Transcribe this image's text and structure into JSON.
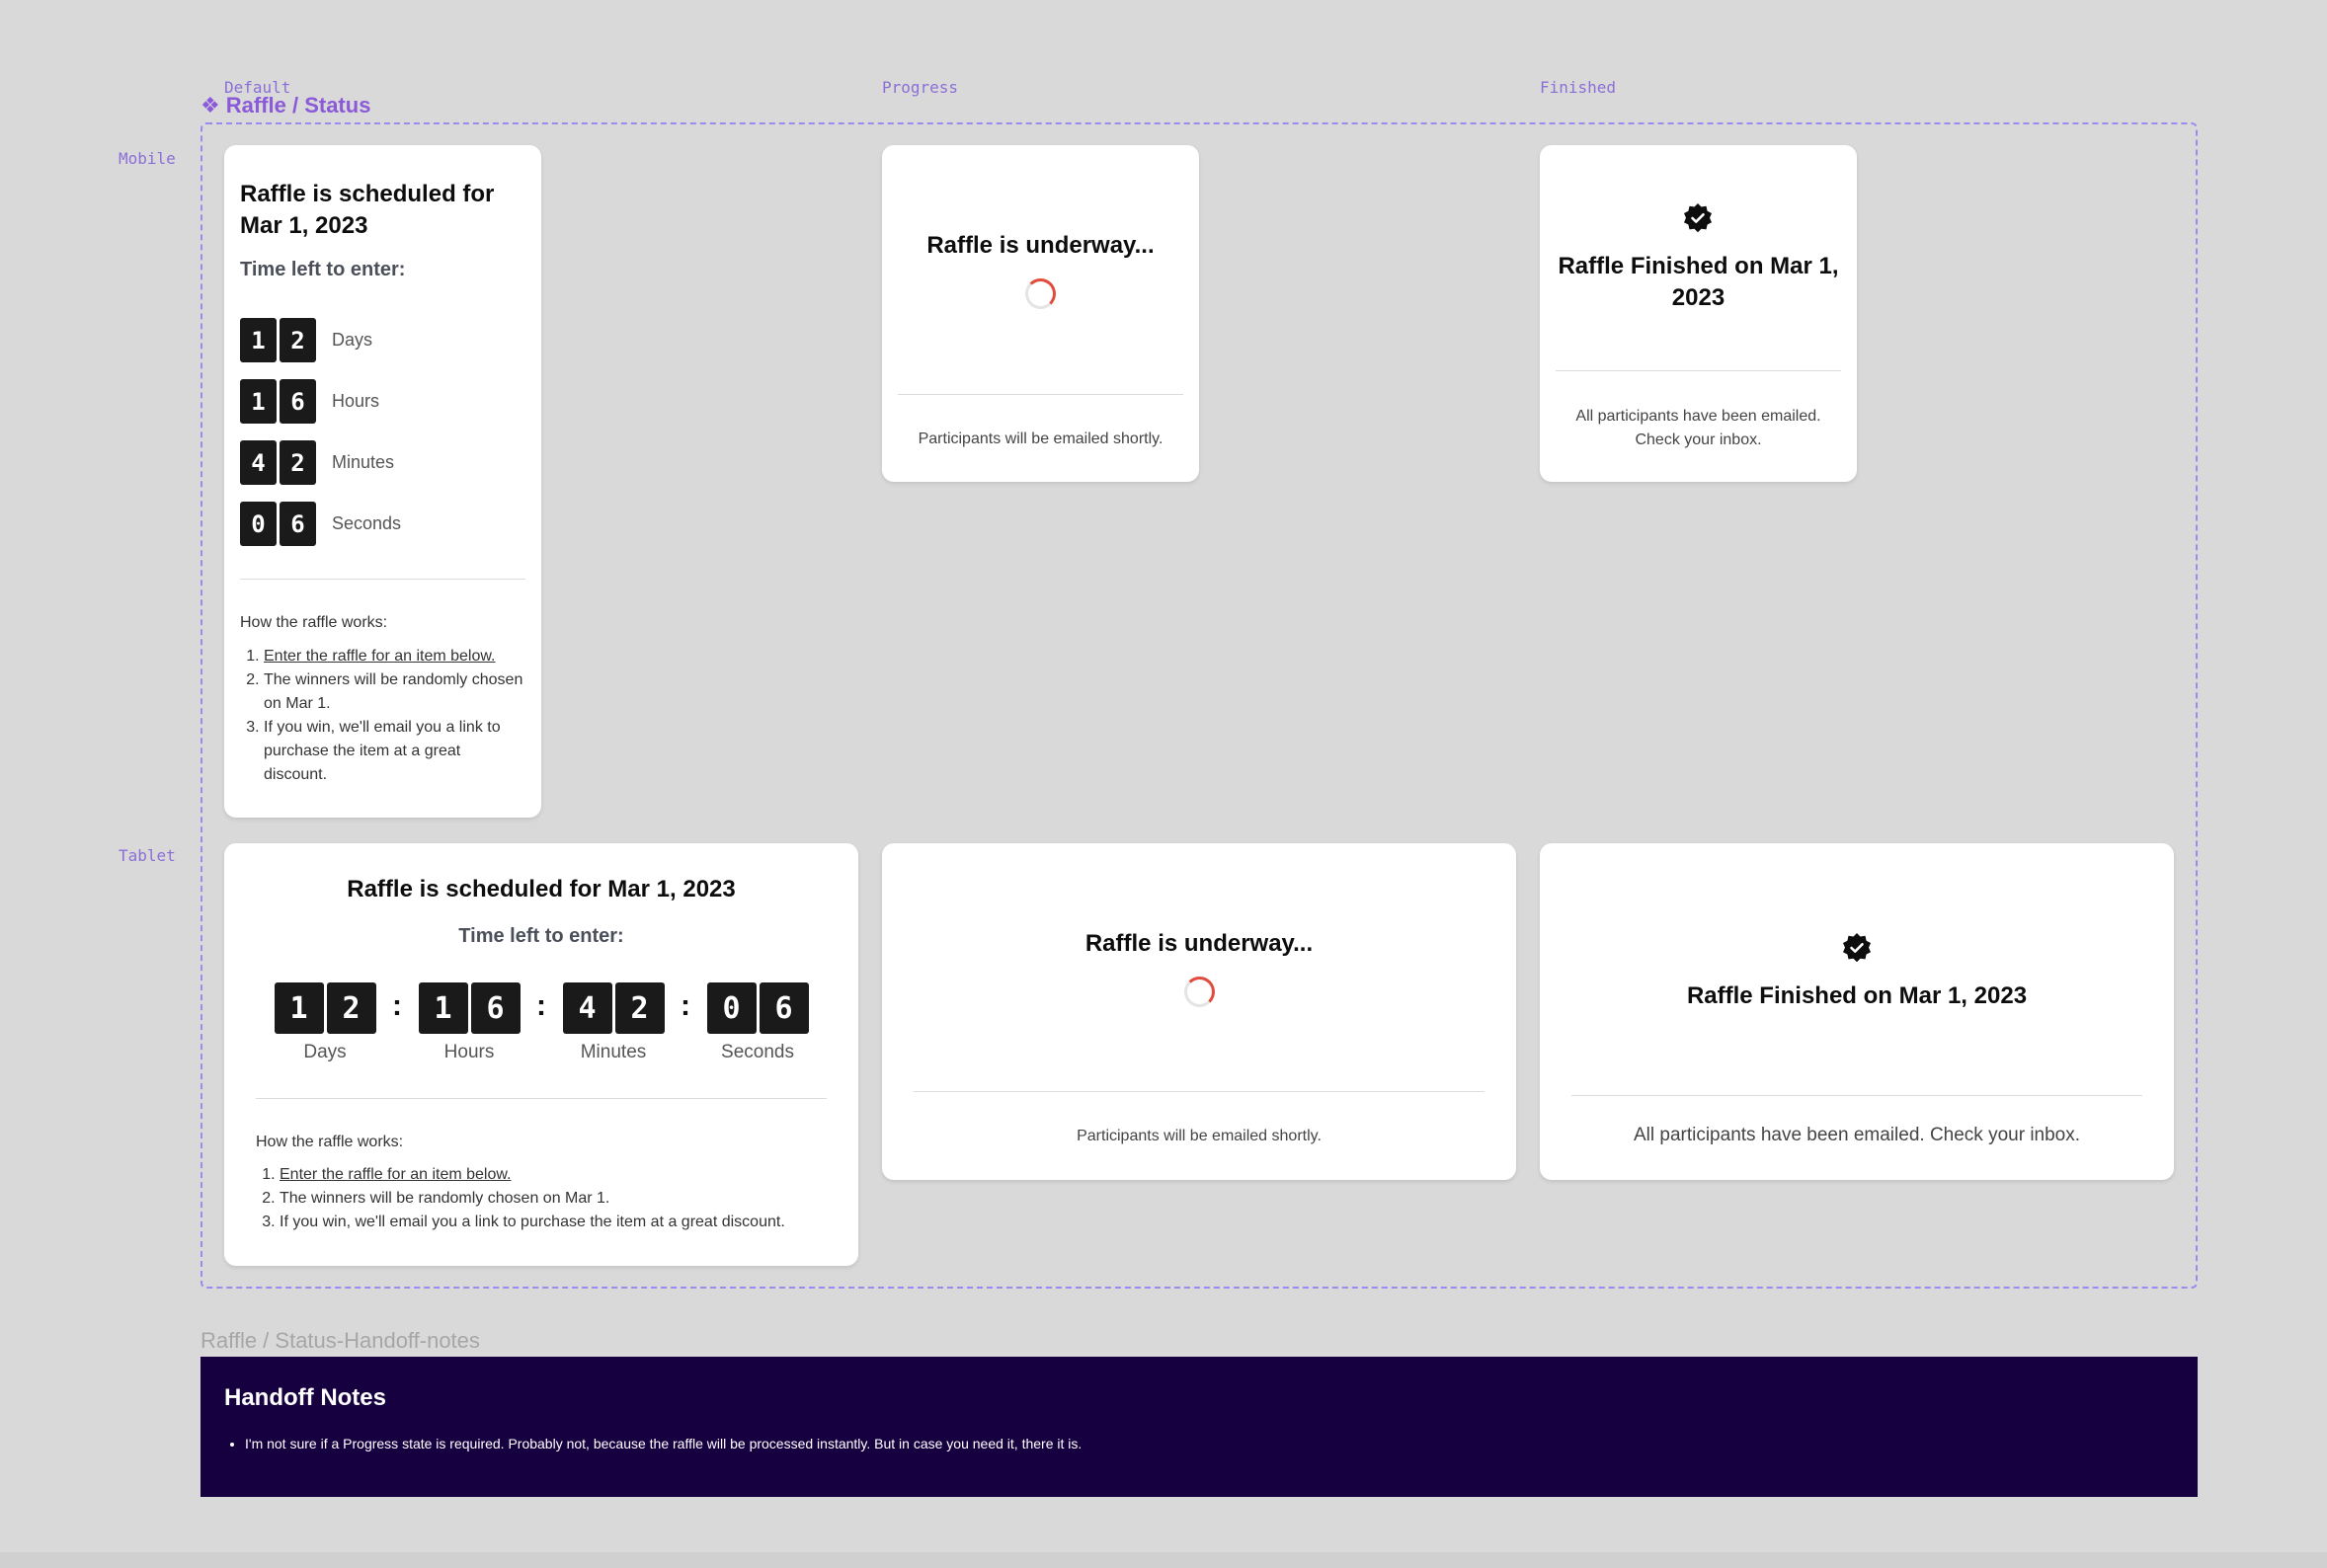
{
  "columns": [
    "Default",
    "Progress",
    "Finished"
  ],
  "rows": [
    "Mobile",
    "Tablet"
  ],
  "component_title": "Raffle / Status",
  "component_glyph": "❖",
  "scheduled": {
    "title_mobile": "Raffle is scheduled for Mar 1, 2023",
    "title_tablet": "Raffle is scheduled for Mar 1, 2023",
    "time_left": "Time left to enter:",
    "units": [
      {
        "digits": [
          "1",
          "2"
        ],
        "label": "Days"
      },
      {
        "digits": [
          "1",
          "6"
        ],
        "label": "Hours"
      },
      {
        "digits": [
          "4",
          "2"
        ],
        "label": "Minutes"
      },
      {
        "digits": [
          "0",
          "6"
        ],
        "label": "Seconds"
      }
    ],
    "separator": ":",
    "how_title": "How the raffle works:",
    "steps": [
      "Enter the raffle for an item below.",
      "The winners will be randomly chosen on Mar 1.",
      "If you win, we'll email you a link to purchase the item at a great discount."
    ]
  },
  "progress": {
    "title": "Raffle is underway...",
    "note": "Participants will be emailed shortly."
  },
  "finished": {
    "title": "Raffle Finished on Mar 1, 2023",
    "note": "All participants have been emailed. Check your inbox.",
    "icon": "check-badge-icon"
  },
  "handoff": {
    "label": "Raffle / Status-Handoff-notes",
    "title": "Handoff Notes",
    "bullet": "I'm not sure if a Progress state is required. Probably not, because the raffle will be processed instantly. But in case you need it, there it is."
  },
  "colors": {
    "accent": "#8b5ad8",
    "spinner": "#e24c3c",
    "handoff_bg": "#16003f"
  }
}
